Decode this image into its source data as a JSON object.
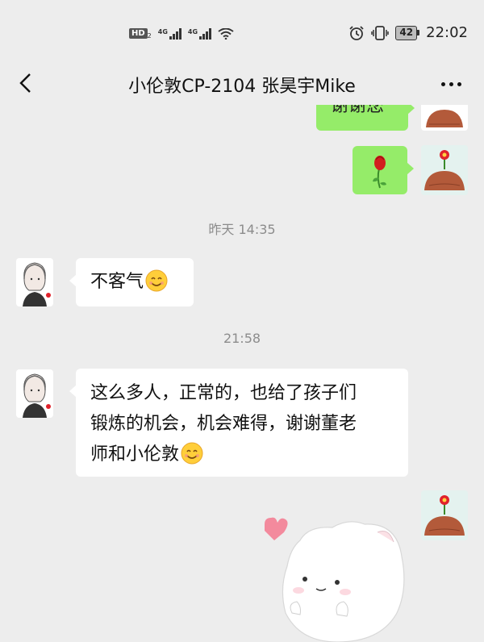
{
  "status_bar": {
    "hd_label": "HD",
    "hd_sub": "2",
    "net1": "4G",
    "net2": "4G",
    "battery_level": "42",
    "time": "22:02"
  },
  "header": {
    "title": "小伦敦CP-2104  张昊宇Mike"
  },
  "messages": {
    "partial_out_text": "谢谢您",
    "time_yesterday": "昨天 14:35",
    "msg1_text": "不客气",
    "time_2158": "21:58",
    "msg2_line1": "这么多人，正常的，也给了孩子们",
    "msg2_line2": "锻炼的机会，机会难得，谢谢董老",
    "msg2_line3": "师和小伦敦"
  },
  "icons": {
    "back": "back-arrow-icon",
    "more": "more-dots-icon",
    "alarm": "alarm-icon",
    "vibrate": "vibrate-icon",
    "wifi": "wifi-icon",
    "smile": "smile-emoji-icon",
    "rose": "rose-icon",
    "heart": "heart-icon"
  },
  "colors": {
    "background": "#ededed",
    "bubble_in": "#ffffff",
    "bubble_out": "#95ec69",
    "time_label": "#8c8c8c"
  }
}
